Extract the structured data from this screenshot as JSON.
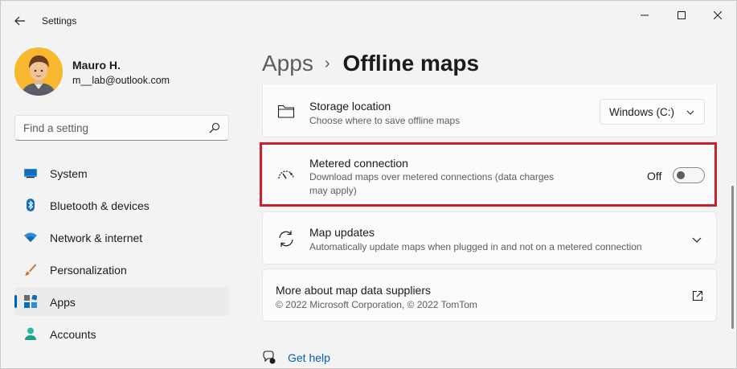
{
  "window": {
    "title": "Settings"
  },
  "user": {
    "name": "Mauro H.",
    "email": "m__lab@outlook.com"
  },
  "search": {
    "placeholder": "Find a setting"
  },
  "nav": {
    "items": [
      {
        "label": "System",
        "icon": "monitor-icon"
      },
      {
        "label": "Bluetooth & devices",
        "icon": "bluetooth-icon"
      },
      {
        "label": "Network & internet",
        "icon": "wifi-icon"
      },
      {
        "label": "Personalization",
        "icon": "brush-icon"
      },
      {
        "label": "Apps",
        "icon": "apps-icon",
        "selected": true
      },
      {
        "label": "Accounts",
        "icon": "person-icon"
      }
    ]
  },
  "breadcrumb": {
    "parent": "Apps",
    "separator": "›",
    "current": "Offline maps"
  },
  "settings": {
    "storage": {
      "title": "Storage location",
      "description": "Choose where to save offline maps",
      "selected_drive": "Windows (C:)"
    },
    "metered": {
      "title": "Metered connection",
      "description": "Download maps over metered connections (data charges may apply)",
      "toggle_state": "Off"
    },
    "updates": {
      "title": "Map updates",
      "description": "Automatically update maps when plugged in and not on a metered connection"
    },
    "suppliers": {
      "title": "More about map data suppliers",
      "description": "© 2022 Microsoft Corporation, © 2022 TomTom"
    }
  },
  "help": {
    "label": "Get help"
  },
  "colors": {
    "accent": "#005fb8",
    "highlight": "#c8202f"
  }
}
